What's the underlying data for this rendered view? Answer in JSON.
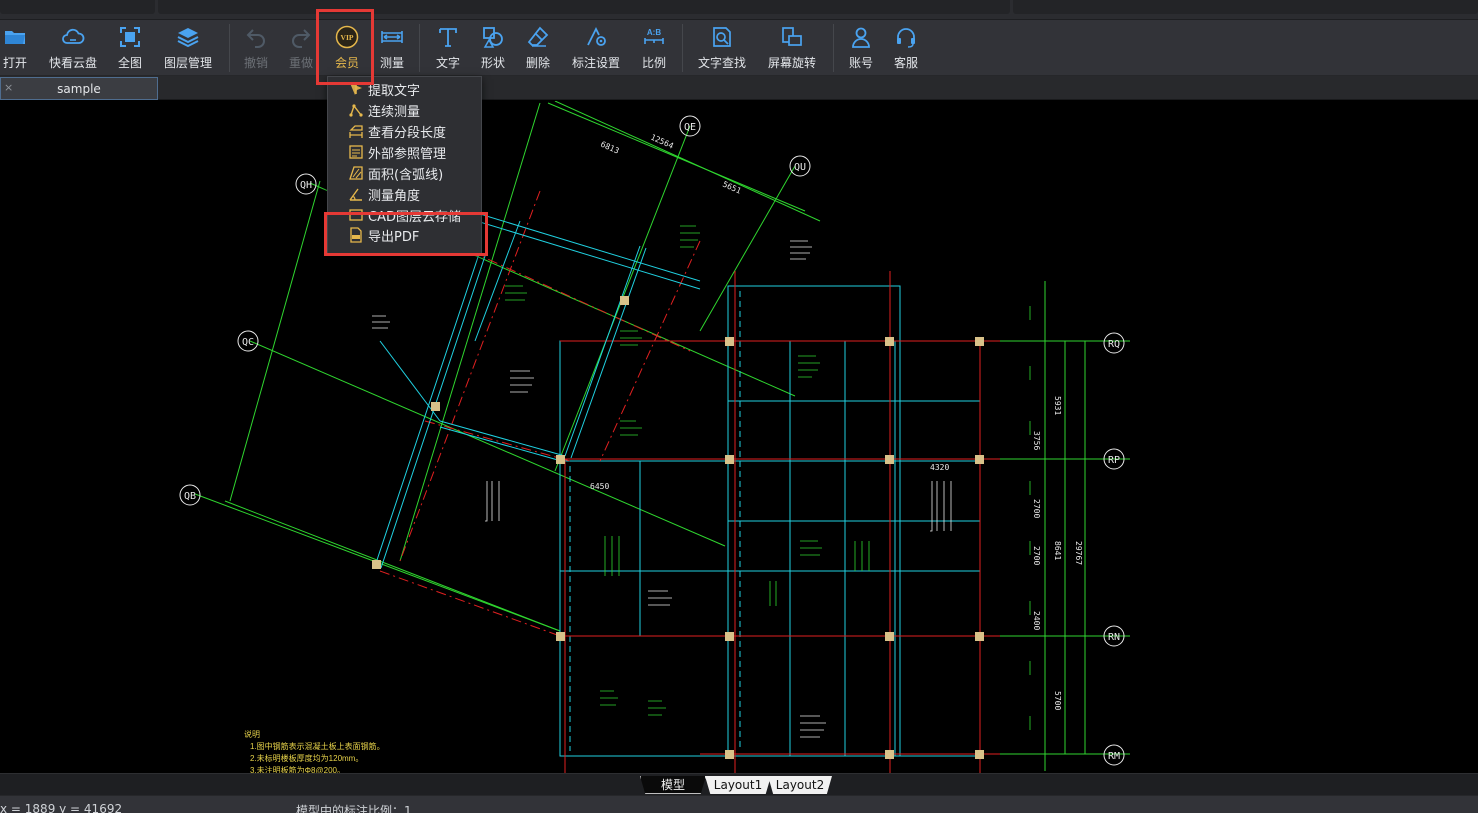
{
  "toolbar": {
    "items": [
      {
        "label": "打开",
        "icon": "folder-open-icon"
      },
      {
        "label": "快看云盘",
        "icon": "cloud-icon"
      },
      {
        "label": "全图",
        "icon": "zoom-extents-icon"
      },
      {
        "label": "图层管理",
        "icon": "layers-icon"
      },
      {
        "label": "撤销",
        "icon": "undo-icon"
      },
      {
        "label": "重做",
        "icon": "redo-icon"
      },
      {
        "label": "会员",
        "icon": "vip-icon",
        "badge": "VIP"
      },
      {
        "label": "测量",
        "icon": "measure-icon"
      },
      {
        "label": "文字",
        "icon": "text-icon"
      },
      {
        "label": "形状",
        "icon": "shape-icon"
      },
      {
        "label": "删除",
        "icon": "eraser-icon"
      },
      {
        "label": "标注设置",
        "icon": "annotation-settings-icon"
      },
      {
        "label": "比例",
        "icon": "scale-icon",
        "badge": "A:B"
      },
      {
        "label": "文字查找",
        "icon": "text-search-icon"
      },
      {
        "label": "屏幕旋转",
        "icon": "rotate-screen-icon"
      },
      {
        "label": "账号",
        "icon": "account-icon"
      },
      {
        "label": "客服",
        "icon": "headset-icon"
      }
    ]
  },
  "tabs": [
    {
      "label": "sample",
      "close": "×"
    }
  ],
  "vip_menu": {
    "items": [
      {
        "label": "提取文字",
        "icon": "extract-text-icon"
      },
      {
        "label": "连续测量",
        "icon": "continuous-measure-icon"
      },
      {
        "label": "查看分段长度",
        "icon": "segment-length-icon"
      },
      {
        "label": "外部参照管理",
        "icon": "xref-icon"
      },
      {
        "label": "面积(含弧线)",
        "icon": "area-icon"
      },
      {
        "label": "测量角度",
        "icon": "angle-icon"
      },
      {
        "label": "CAD图层云存储",
        "icon": "cad-cloud-icon"
      },
      {
        "label": "导出PDF",
        "icon": "pdf-export-icon"
      }
    ]
  },
  "drawing": {
    "grid_labels": [
      "QE",
      "QU",
      "QH",
      "QC",
      "QB",
      "RQ",
      "RP",
      "RN",
      "RM"
    ],
    "dims": [
      "6813",
      "12564",
      "5651",
      "6450",
      "4320",
      "2700",
      "5931",
      "3756",
      "2400",
      "2700",
      "8641",
      "29767",
      "5700"
    ],
    "notes_title": "说明",
    "notes": [
      "1.图中钢筋表示混凝土板上表面钢筋。",
      "2.未标明楼板厚度均为120mm。",
      "3.未注明板筋为Φ8@200。"
    ]
  },
  "layouts": [
    {
      "label": "模型",
      "active": true
    },
    {
      "label": "Layout1",
      "active": false
    },
    {
      "label": "Layout2",
      "active": false
    }
  ],
  "status": {
    "coords": "x = 1889 y = 41692",
    "scale_label": "模型中的标注比例：1"
  },
  "colors": {
    "toolbar_bg": "#323338",
    "icon_blue": "#4aa3f0",
    "vip_gold": "#e6b84c",
    "highlight_red": "#e53935",
    "cad_green": "#2fd52f",
    "cad_red": "#e02020",
    "cad_cyan": "#20d0e0",
    "cad_white": "#e8e8e8",
    "cad_yellow": "#e6d24a"
  }
}
